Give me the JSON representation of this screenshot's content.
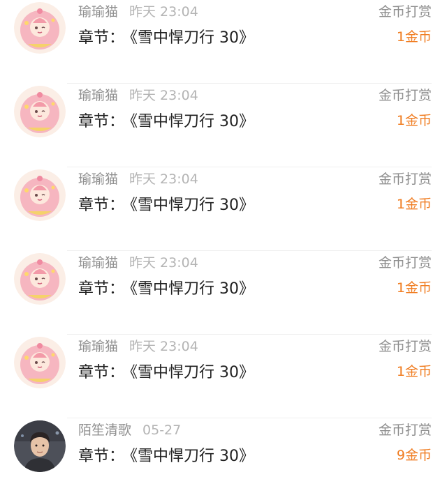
{
  "rewards": [
    {
      "user": "瑜瑜猫",
      "time": "昨天 23:04",
      "chapter_label": "章节：",
      "chapter_title": "《雪中悍刀行 30》",
      "kind": "金币打赏",
      "amount": "1金币",
      "avatar": "anime-girl-avatar"
    },
    {
      "user": "瑜瑜猫",
      "time": "昨天 23:04",
      "chapter_label": "章节：",
      "chapter_title": "《雪中悍刀行 30》",
      "kind": "金币打赏",
      "amount": "1金币",
      "avatar": "anime-girl-avatar"
    },
    {
      "user": "瑜瑜猫",
      "time": "昨天 23:04",
      "chapter_label": "章节：",
      "chapter_title": "《雪中悍刀行 30》",
      "kind": "金币打赏",
      "amount": "1金币",
      "avatar": "anime-girl-avatar"
    },
    {
      "user": "瑜瑜猫",
      "time": "昨天 23:04",
      "chapter_label": "章节：",
      "chapter_title": "《雪中悍刀行 30》",
      "kind": "金币打赏",
      "amount": "1金币",
      "avatar": "anime-girl-avatar"
    },
    {
      "user": "瑜瑜猫",
      "time": "昨天 23:04",
      "chapter_label": "章节：",
      "chapter_title": "《雪中悍刀行 30》",
      "kind": "金币打赏",
      "amount": "1金币",
      "avatar": "anime-girl-avatar"
    },
    {
      "user": "陌笙清歌",
      "time": "05-27",
      "chapter_label": "章节：",
      "chapter_title": "《雪中悍刀行 30》",
      "kind": "金币打赏",
      "amount": "9金币",
      "avatar": "man-photo-avatar"
    }
  ],
  "colors": {
    "accent": "#f07d22",
    "meta_text": "#8f8f8f",
    "main_text": "#222222",
    "divider": "#efefef"
  }
}
